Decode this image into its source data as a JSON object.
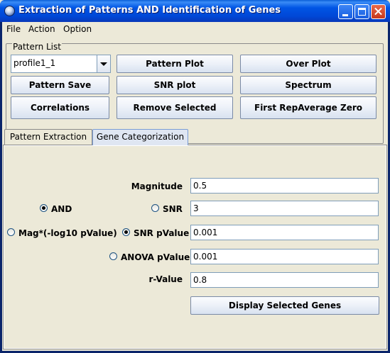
{
  "window": {
    "title": "Extraction of Patterns AND Identification of Genes"
  },
  "menu": {
    "file": "File",
    "action": "Action",
    "option": "Option"
  },
  "pattern_list": {
    "label": "Pattern List",
    "profile_select": {
      "value": "profile1_1"
    },
    "buttons": {
      "pattern_plot": "Pattern Plot",
      "over_plot": "Over Plot",
      "pattern_save": "Pattern Save",
      "snr_plot": "SNR plot",
      "spectrum": "Spectrum",
      "correlations": "Correlations",
      "remove_selected": "Remove Selected",
      "first_rep_average_zero": "First RepAverage Zero"
    }
  },
  "tabs": {
    "pattern_extraction": "Pattern Extraction",
    "gene_categorization": "Gene Categorization",
    "active": "gene_categorization"
  },
  "gene_categorization": {
    "magnitude": {
      "label": "Magnitude",
      "value": "0.5"
    },
    "and_option": {
      "label": "AND",
      "checked": true
    },
    "snr": {
      "label": "SNR",
      "value": "3",
      "checked": false
    },
    "mag_option": {
      "label": "Mag*(-log10 pValue)",
      "checked": false
    },
    "snr_pvalue": {
      "label": "SNR pValue",
      "value": "0.001",
      "checked": true
    },
    "anova_pvalue": {
      "label": "ANOVA pValue",
      "value": "0.001",
      "checked": false
    },
    "r_value": {
      "label": "r-Value",
      "value": "0.8"
    },
    "display_button": "Display Selected Genes"
  }
}
